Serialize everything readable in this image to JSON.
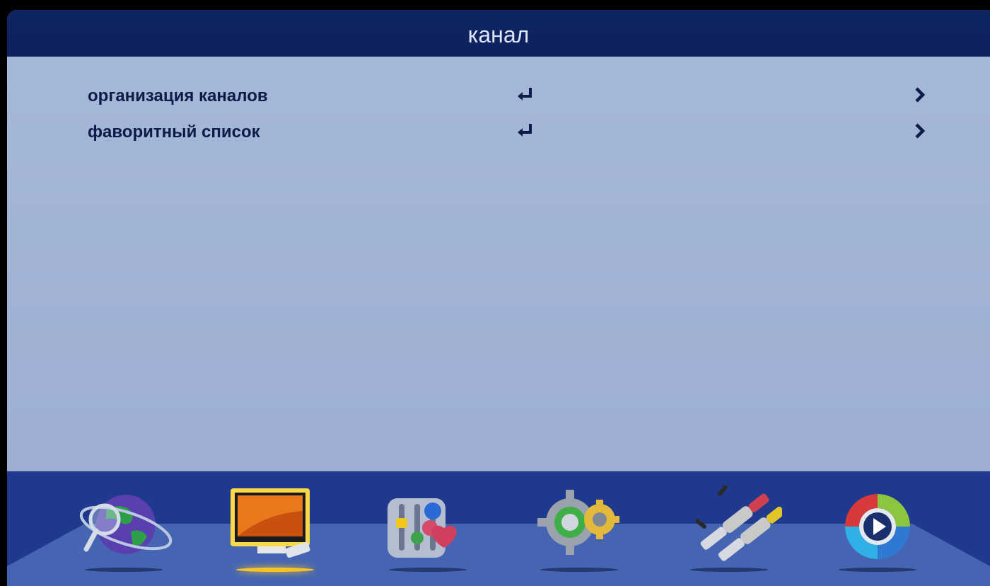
{
  "title": "канал",
  "menu": {
    "items": [
      {
        "label": "организация каналов",
        "action_icon": "enter-icon",
        "nav_icon": "chevron-right-icon"
      },
      {
        "label": "фаворитный список",
        "action_icon": "enter-icon",
        "nav_icon": "chevron-right-icon"
      }
    ]
  },
  "dock": {
    "selected": "tv-channel-icon",
    "items": [
      {
        "icon": "globe-search-icon"
      },
      {
        "icon": "tv-channel-icon"
      },
      {
        "icon": "equalizer-favorite-icon"
      },
      {
        "icon": "gears-settings-icon"
      },
      {
        "icon": "av-cables-icon"
      },
      {
        "icon": "media-player-icon"
      }
    ]
  },
  "colors": {
    "title_bar": "#0e2463",
    "content_bg": "#a2b4d6",
    "text": "#0c1b47",
    "dock_bg": "#1f3a8c",
    "highlight": "#f7c425"
  }
}
